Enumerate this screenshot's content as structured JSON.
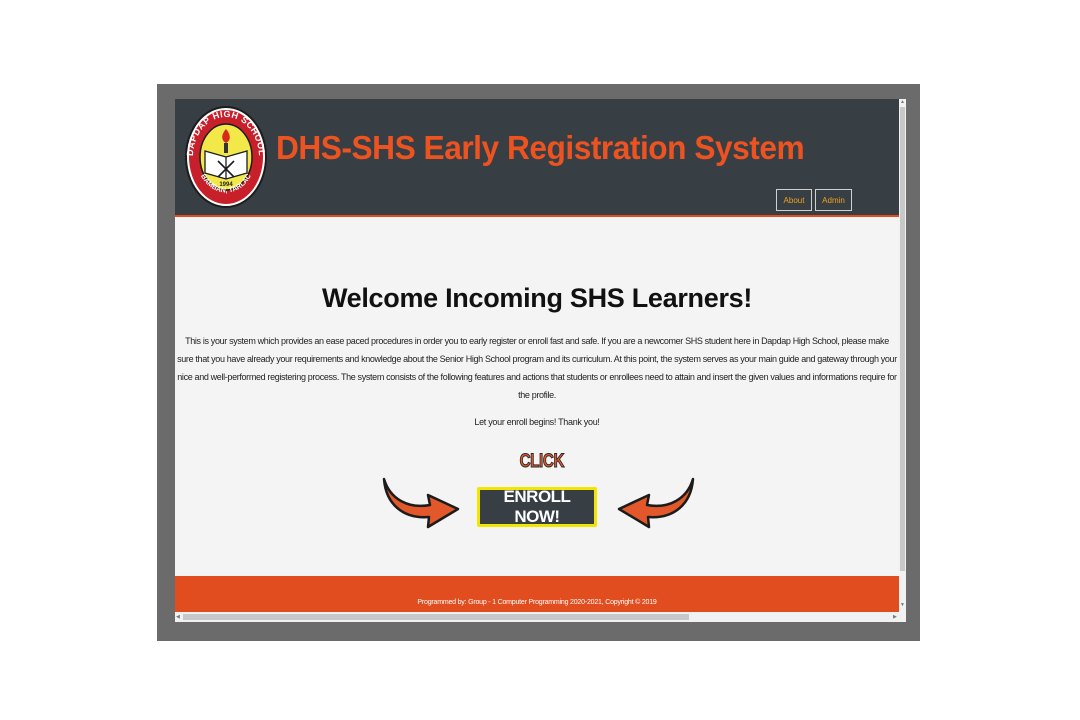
{
  "header": {
    "title": "DHS-SHS Early Registration System",
    "logo": {
      "icon": "school-seal-logo",
      "ring_top_text": "DAPDAP HIGH SCHOOL",
      "ring_bottom_text": "BAMBAN, TARLAC",
      "year": "1994"
    },
    "nav": [
      {
        "label": "About"
      },
      {
        "label": "Admin"
      }
    ]
  },
  "main": {
    "welcome": "Welcome Incoming SHS Learners!",
    "description": "This is your system which provides an ease paced procedures in order you to early register or enroll fast and safe. If you are a newcomer SHS student here in Dapdap High School, please make sure that you have already your requirements and knowledge about the Senior High School program and its curriculum. At this point, the system serves as your main guide and gateway through your nice and well-performed registering process. The system consists of the following features and actions that students or enrollees need to attain and insert the given values and informations require for the profile.",
    "closing": "Let your enroll begins! Thank you!",
    "click_label": "CLICK",
    "enroll_button": "ENROLL NOW!"
  },
  "footer": {
    "text": "Programmed by: Group - 1 Computer Programming 2020-2021, Copyright © 2019"
  },
  "colors": {
    "header_bg": "#373f45",
    "accent": "#e24d1f",
    "button_border": "#f2e600",
    "page_bg": "#f4f4f4"
  }
}
